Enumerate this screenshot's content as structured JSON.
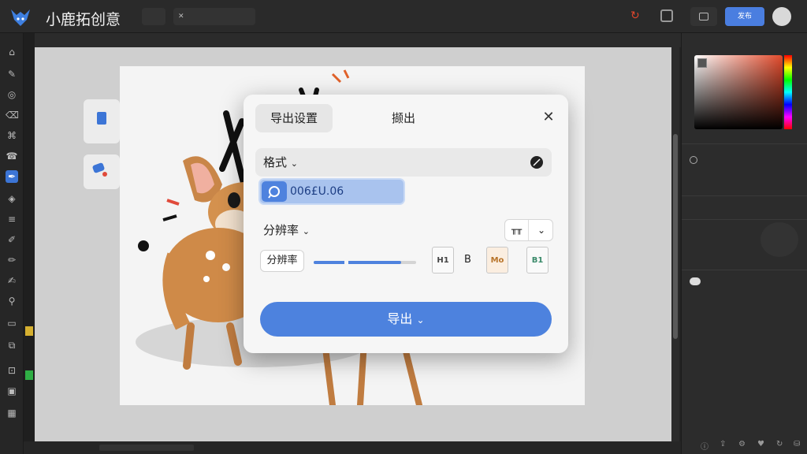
{
  "app": {
    "title": "小鹿拓创意"
  },
  "topbar": {
    "primary_button": "发布"
  },
  "dialog": {
    "tabs": [
      {
        "label": "导出设置"
      },
      {
        "label": "撷出"
      }
    ],
    "format_label": "格式",
    "search_value": "006£U.06",
    "resolution_label": "分辨率",
    "unit_value": "╥╥",
    "resolution_button": "分辨率",
    "slider_fraction": 0.85,
    "file_types": [
      {
        "label": "H1"
      },
      {
        "label": "Mo"
      },
      {
        "label": "B1"
      }
    ],
    "b_label": "B",
    "export_button": "导出"
  },
  "colors": {
    "accent": "#4d82de",
    "bg_dark": "#232323",
    "dialog_bg": "#f6f6f6"
  }
}
